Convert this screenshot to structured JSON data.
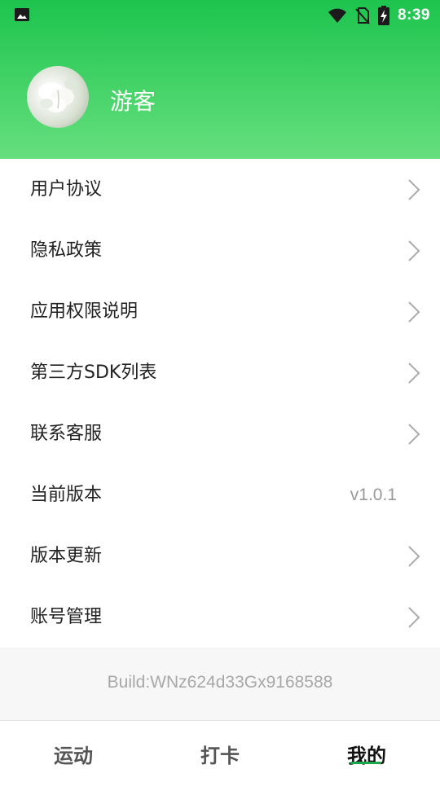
{
  "status_bar": {
    "time": "8:39",
    "left_icon": "image-icon",
    "icons": [
      "wifi-icon",
      "no-sim-icon",
      "battery-charging-icon"
    ]
  },
  "profile": {
    "avatar_icon": "avatar-flower-image",
    "username": "游客"
  },
  "menu": {
    "items": [
      {
        "label": "用户协议"
      },
      {
        "label": "隐私政策"
      },
      {
        "label": "应用权限说明"
      },
      {
        "label": "第三方SDK列表"
      },
      {
        "label": "联系客服"
      },
      {
        "label": "当前版本",
        "value": "v1.0.1"
      },
      {
        "label": "版本更新"
      },
      {
        "label": "账号管理"
      }
    ]
  },
  "build": {
    "text": "Build:WNz624d33Gx9168588"
  },
  "tabbar": {
    "tabs": [
      {
        "label": "运动"
      },
      {
        "label": "打卡"
      },
      {
        "label": "我的"
      }
    ],
    "active_index": 2
  },
  "colors": {
    "header_top": "#1dc44e",
    "header_bottom": "#66df7e",
    "accent": "#1aa84a"
  }
}
